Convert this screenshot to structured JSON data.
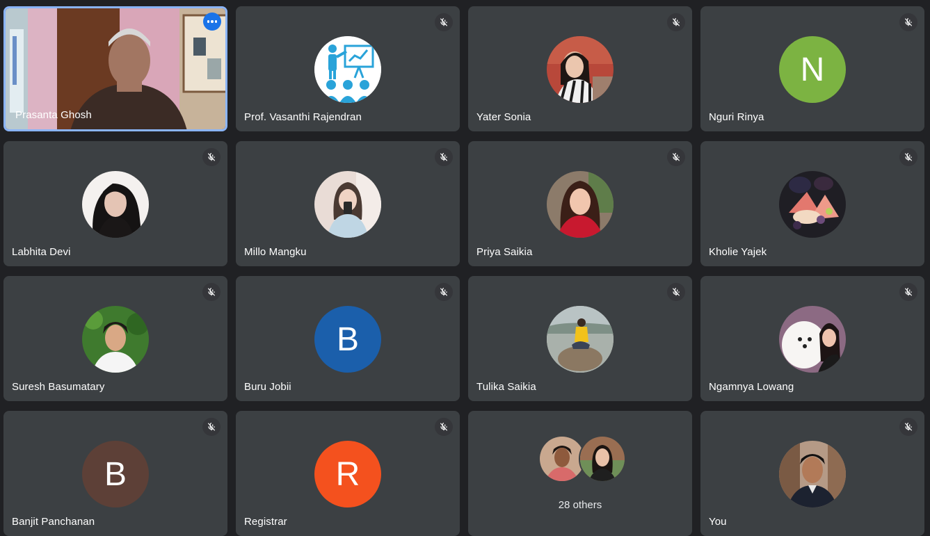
{
  "meeting": {
    "self_label": "You",
    "others_label": "28 others",
    "active_speaker": {
      "name": "Prasanta Ghosh",
      "more_options_label": "More options"
    },
    "participants": [
      {
        "name": "Prof. Vasanthi Rajendran",
        "avatar": "presentation-icon-avatar",
        "muted": true
      },
      {
        "name": "Yater Sonia",
        "avatar": "photo",
        "muted": true
      },
      {
        "name": "Nguri Rinya",
        "avatar_letter": "N",
        "avatar_color": "#7cb342",
        "muted": true
      },
      {
        "name": "Labhita Devi",
        "avatar": "photo",
        "muted": true
      },
      {
        "name": "Millo Mangku",
        "avatar": "photo",
        "muted": true
      },
      {
        "name": "Priya Saikia",
        "avatar": "photo",
        "muted": true
      },
      {
        "name": "Kholie Yajek",
        "avatar": "photo",
        "muted": true
      },
      {
        "name": "Suresh Basumatary",
        "avatar": "photo",
        "muted": true
      },
      {
        "name": "Buru Jobii",
        "avatar_letter": "B",
        "avatar_color": "#1b5fab",
        "muted": true
      },
      {
        "name": "Tulika Saikia",
        "avatar": "photo",
        "muted": true
      },
      {
        "name": "Ngamnya Lowang",
        "avatar": "photo",
        "muted": true
      },
      {
        "name": "Banjit Panchanan",
        "avatar_letter": "B",
        "avatar_color": "#5d4037",
        "muted": true
      },
      {
        "name": "Registrar",
        "avatar_letter": "R",
        "avatar_color": "#f4511e",
        "muted": true
      }
    ]
  },
  "colors": {
    "background": "#202124",
    "tile": "#3c4043",
    "speaking_border": "#8ab4f8",
    "accent": "#1a73e8"
  },
  "icons": {
    "mute": "mic-off-icon",
    "more": "more-horizontal-icon"
  }
}
